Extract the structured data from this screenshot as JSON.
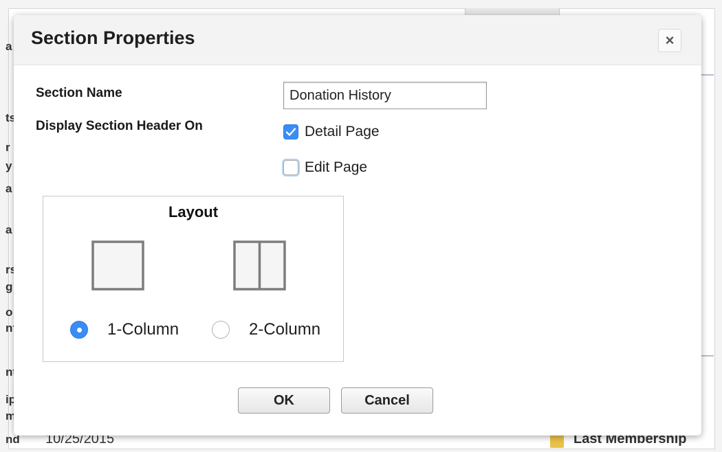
{
  "background": {
    "left_slivers": [
      "a",
      "ts",
      "r",
      "y",
      "a",
      "a",
      "rs",
      "g",
      "o",
      "nf",
      "nt",
      "ip",
      "m",
      "nd"
    ],
    "bottom_date": "10/25/2015",
    "bottom_right_label": "Last Membership"
  },
  "dialog": {
    "title": "Section Properties",
    "close_label": "×",
    "section_name_label": "Section Name",
    "section_name_value": "Donation History",
    "display_header_label": "Display Section Header On",
    "options": [
      {
        "label": "Detail Page",
        "checked": true
      },
      {
        "label": "Edit Page",
        "checked": false
      }
    ],
    "layout": {
      "title": "Layout",
      "choices": [
        {
          "label": "1-Column",
          "selected": true
        },
        {
          "label": "2-Column",
          "selected": false
        }
      ]
    },
    "ok_label": "OK",
    "cancel_label": "Cancel"
  },
  "colors": {
    "accent": "#3a8df5",
    "header_bg": "#f3f3f3"
  }
}
